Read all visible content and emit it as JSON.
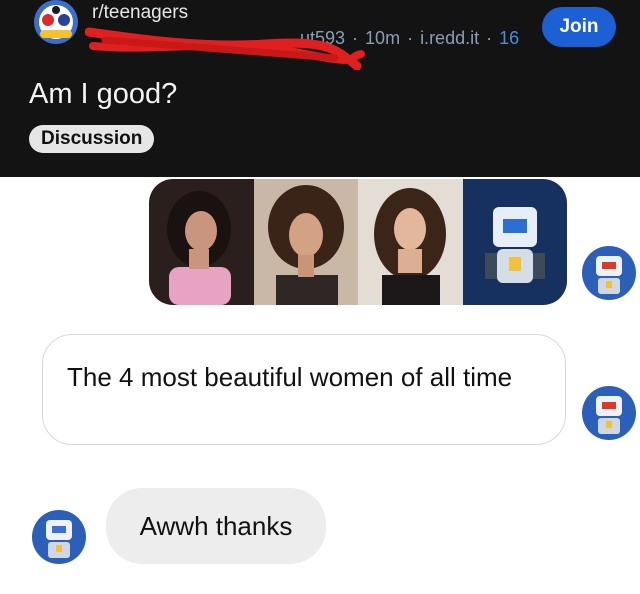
{
  "post": {
    "subreddit": "r/teenagers",
    "author_tail": "ut593",
    "time": "10m",
    "domain": "i.redd.it",
    "score": "16",
    "join_label": "Join",
    "title": "Am I good?",
    "flair": "Discussion"
  },
  "chat": {
    "sent_message": "The 4 most beautiful women of all time",
    "received_message": "Awwh thanks"
  },
  "colors": {
    "header_bg": "#131313",
    "join_button": "#1d5fd4",
    "scribble": "#e02020",
    "bubble_received": "#ededed"
  },
  "icons": {
    "subreddit_avatar": "subreddit-avatar-icon",
    "profile_avatar": "robot-avatar-icon"
  }
}
